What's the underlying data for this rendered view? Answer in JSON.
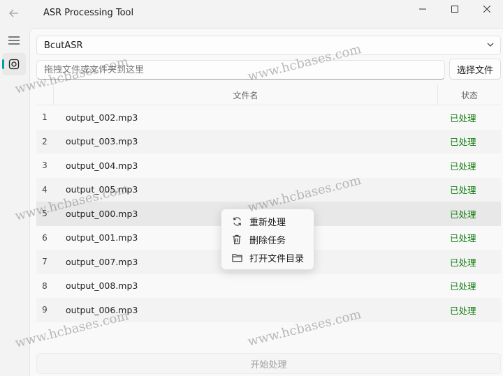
{
  "window": {
    "title": "ASR Processing Tool",
    "back_icon": "arrow-left-icon",
    "minimize_icon": "minimize-icon",
    "maximize_icon": "maximize-icon",
    "close_icon": "close-icon"
  },
  "nav": {
    "menu_icon": "hamburger-menu-icon",
    "active_item_icon": "target-icon",
    "accent": "#009faa"
  },
  "engine_select": {
    "value": "BcutASR"
  },
  "file_input": {
    "placeholder": "拖拽文件或文件夹到这里"
  },
  "select_file_button": {
    "label": "选择文件"
  },
  "table": {
    "columns": [
      "文件名",
      "状态"
    ],
    "rows": [
      {
        "index": "1",
        "name": "output_002.mp3",
        "status": "已处理"
      },
      {
        "index": "2",
        "name": "output_003.mp3",
        "status": "已处理"
      },
      {
        "index": "3",
        "name": "output_004.mp3",
        "status": "已处理"
      },
      {
        "index": "4",
        "name": "output_005.mp3",
        "status": "已处理"
      },
      {
        "index": "5",
        "name": "output_000.mp3",
        "status": "已处理"
      },
      {
        "index": "6",
        "name": "output_001.mp3",
        "status": "已处理"
      },
      {
        "index": "7",
        "name": "output_007.mp3",
        "status": "已处理"
      },
      {
        "index": "8",
        "name": "output_008.mp3",
        "status": "已处理"
      },
      {
        "index": "9",
        "name": "output_006.mp3",
        "status": "已处理"
      }
    ],
    "status_color": "#0f7b0f"
  },
  "start_button": {
    "label": "开始处理"
  },
  "context_menu": {
    "items": [
      {
        "label": "重新处理",
        "icon": "refresh-icon"
      },
      {
        "label": "删除任务",
        "icon": "trash-icon"
      },
      {
        "label": "打开文件目录",
        "icon": "folder-icon"
      }
    ]
  },
  "watermark": {
    "text": "www.hcbases.com"
  }
}
